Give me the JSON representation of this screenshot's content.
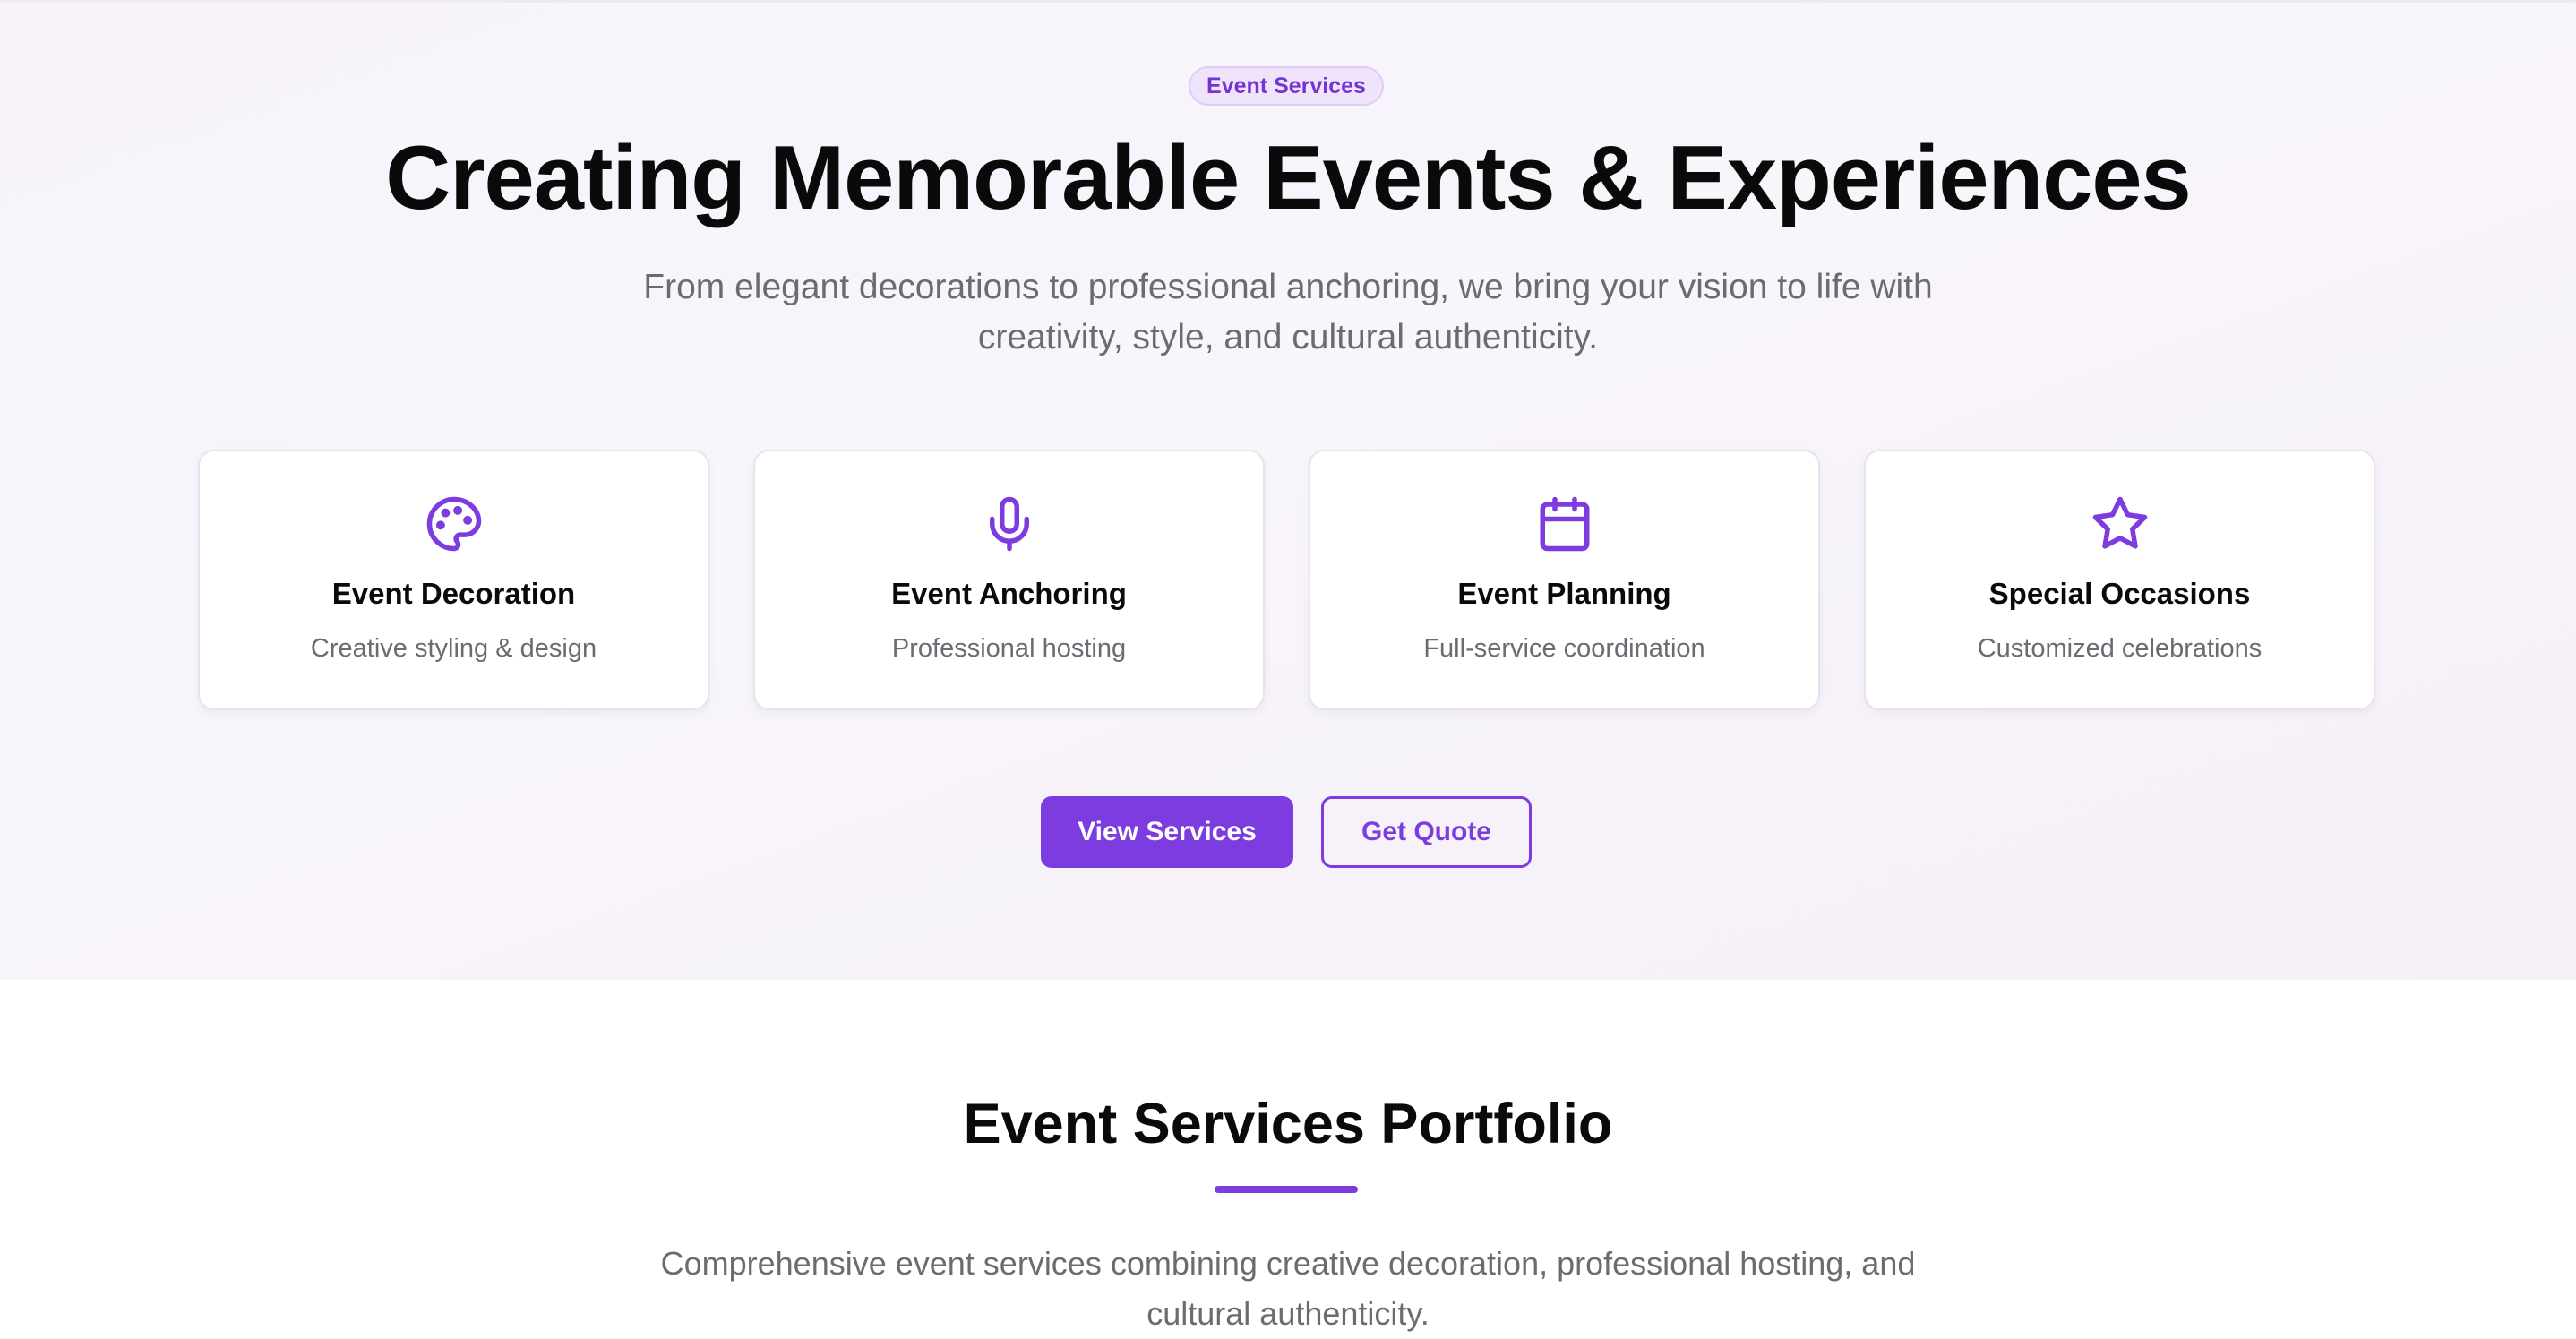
{
  "hero": {
    "badge": "Event Services",
    "title": "Creating Memorable Events & Experiences",
    "subtitle": "From elegant decorations to professional anchoring, we bring your vision to life with creativity, style, and cultural authenticity."
  },
  "cards": [
    {
      "icon": "palette-icon",
      "title": "Event Decoration",
      "subtitle": "Creative styling & design"
    },
    {
      "icon": "microphone-icon",
      "title": "Event Anchoring",
      "subtitle": "Professional hosting"
    },
    {
      "icon": "calendar-icon",
      "title": "Event Planning",
      "subtitle": "Full-service coordination"
    },
    {
      "icon": "star-icon",
      "title": "Special Occasions",
      "subtitle": "Customized celebrations"
    }
  ],
  "actions": {
    "primary_label": "View Services",
    "secondary_label": "Get Quote"
  },
  "portfolio": {
    "title": "Event Services Portfolio",
    "subtitle": "Comprehensive event services combining creative decoration, professional hosting, and cultural authenticity."
  },
  "colors": {
    "accent": "#7c3ce0",
    "badge_bg": "#efe4fb",
    "text_muted": "#6b6b72"
  }
}
